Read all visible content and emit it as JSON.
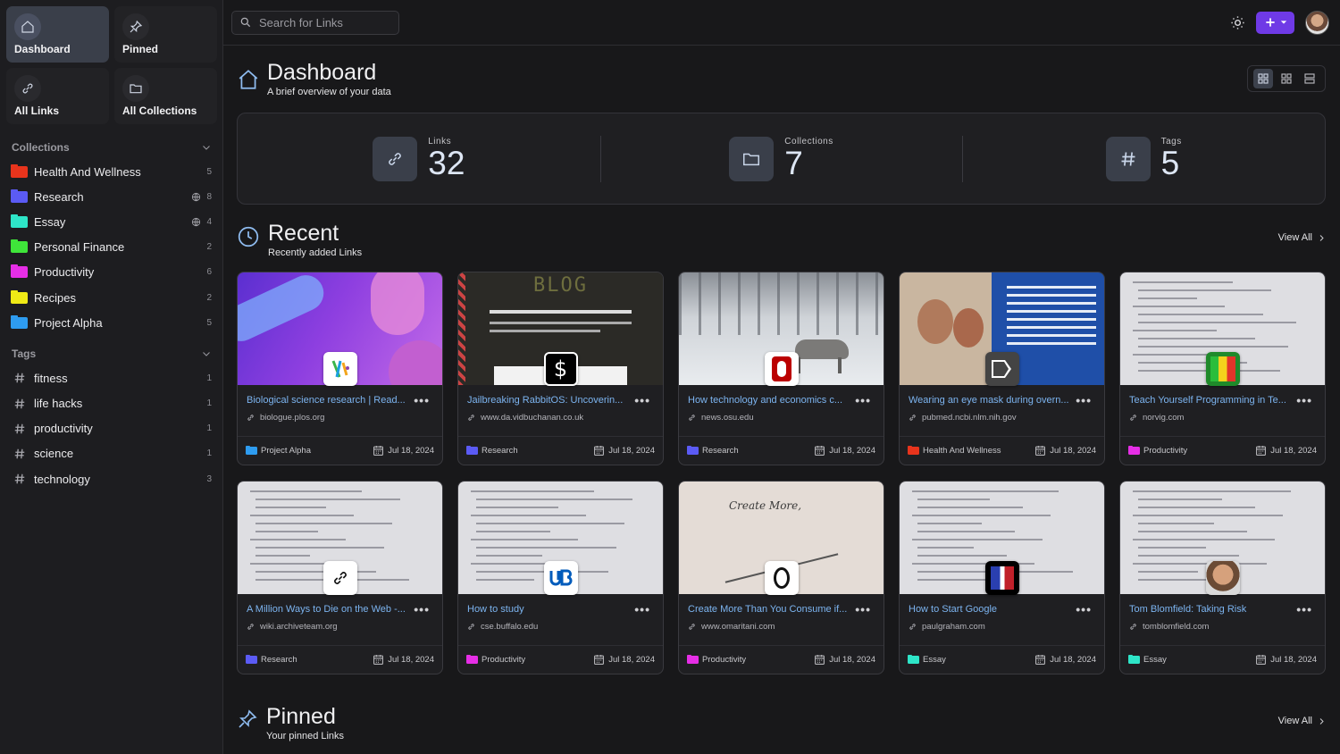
{
  "sidebar": {
    "quick": [
      {
        "label": "Dashboard",
        "icon": "home-icon"
      },
      {
        "label": "Pinned",
        "icon": "pin-icon"
      },
      {
        "label": "All Links",
        "icon": "link-icon"
      },
      {
        "label": "All Collections",
        "icon": "folder-icon"
      }
    ],
    "collections_heading": "Collections",
    "collections": [
      {
        "name": "Health And Wellness",
        "count": "5",
        "color": "#e8341c",
        "shared": false
      },
      {
        "name": "Research",
        "count": "8",
        "color": "#5b5bf5",
        "shared": true
      },
      {
        "name": "Essay",
        "count": "4",
        "color": "#2ee5c8",
        "shared": true
      },
      {
        "name": "Personal Finance",
        "count": "2",
        "color": "#3fe53a",
        "shared": false
      },
      {
        "name": "Productivity",
        "count": "6",
        "color": "#e62ee6",
        "shared": false
      },
      {
        "name": "Recipes",
        "count": "2",
        "color": "#f0ea16",
        "shared": false
      },
      {
        "name": "Project Alpha",
        "count": "5",
        "color": "#2e9cf0",
        "shared": false
      }
    ],
    "tags_heading": "Tags",
    "tags": [
      {
        "name": "fitness",
        "count": "1"
      },
      {
        "name": "life hacks",
        "count": "1"
      },
      {
        "name": "productivity",
        "count": "1"
      },
      {
        "name": "science",
        "count": "1"
      },
      {
        "name": "technology",
        "count": "3"
      }
    ]
  },
  "topbar": {
    "search_placeholder": "Search for Links"
  },
  "header": {
    "title": "Dashboard",
    "subtitle": "A brief overview of your data"
  },
  "stats": [
    {
      "label": "Links",
      "value": "32",
      "icon": "link-icon"
    },
    {
      "label": "Collections",
      "value": "7",
      "icon": "folder-icon"
    },
    {
      "label": "Tags",
      "value": "5",
      "icon": "hash-icon"
    }
  ],
  "recent": {
    "title": "Recent",
    "subtitle": "Recently added Links",
    "view_all": "View All"
  },
  "pinned": {
    "title": "Pinned",
    "subtitle": "Your pinned Links",
    "view_all": "View All"
  },
  "links": [
    {
      "title": "Biological science research | Read...",
      "url": "biologue.plos.org",
      "collection": "Project Alpha",
      "color": "#2e9cf0",
      "date": "Jul 18, 2024",
      "thumb": "plos"
    },
    {
      "title": "Jailbreaking RabbitOS: Uncoverin...",
      "url": "www.da.vidbuchanan.co.uk",
      "collection": "Research",
      "color": "#5b5bf5",
      "date": "Jul 18, 2024",
      "thumb": "blog",
      "blog_text": "BLOG"
    },
    {
      "title": "How technology and economics c...",
      "url": "news.osu.edu",
      "collection": "Research",
      "color": "#5b5bf5",
      "date": "Jul 18, 2024",
      "thumb": "wolf"
    },
    {
      "title": "Wearing an eye mask during overn...",
      "url": "pubmed.ncbi.nlm.nih.gov",
      "collection": "Health And Wellness",
      "color": "#e8341c",
      "date": "Jul 18, 2024",
      "thumb": "pubmed"
    },
    {
      "title": "Teach Yourself Programming in Te...",
      "url": "norvig.com",
      "collection": "Productivity",
      "color": "#e62ee6",
      "date": "Jul 18, 2024",
      "thumb": "doc"
    },
    {
      "title": "A Million Ways to Die on the Web -...",
      "url": "wiki.archiveteam.org",
      "collection": "Research",
      "color": "#5b5bf5",
      "date": "Jul 18, 2024",
      "thumb": "doc"
    },
    {
      "title": "How to study",
      "url": "cse.buffalo.edu",
      "collection": "Productivity",
      "color": "#e62ee6",
      "date": "Jul 18, 2024",
      "thumb": "doc"
    },
    {
      "title": "Create More Than You Consume if...",
      "url": "www.omaritani.com",
      "collection": "Productivity",
      "color": "#e62ee6",
      "date": "Jul 18, 2024",
      "thumb": "create",
      "thumb_text": "Create More,"
    },
    {
      "title": "How to Start Google",
      "url": "paulgraham.com",
      "collection": "Essay",
      "color": "#2ee5c8",
      "date": "Jul 18, 2024",
      "thumb": "doc"
    },
    {
      "title": "Tom Blomfield: Taking Risk",
      "url": "tomblomfield.com",
      "collection": "Essay",
      "color": "#2ee5c8",
      "date": "Jul 18, 2024",
      "thumb": "doc"
    }
  ]
}
